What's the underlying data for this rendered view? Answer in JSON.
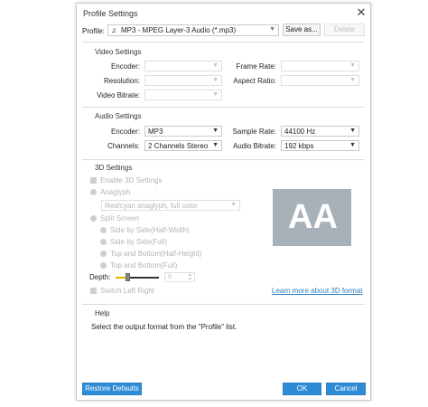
{
  "dialog": {
    "title": "Profile Settings",
    "close_glyph": "✕"
  },
  "profile": {
    "label": "Profile:",
    "value": "MP3 - MPEG Layer-3 Audio (*.mp3)",
    "save_as_label": "Save as...",
    "delete_label": "Delete"
  },
  "video": {
    "section_title": "Video Settings",
    "encoder_label": "Encoder:",
    "resolution_label": "Resolution:",
    "bitrate_label": "Video Bitrate:",
    "frame_rate_label": "Frame Rate:",
    "aspect_ratio_label": "Aspect Ratio:"
  },
  "audio": {
    "section_title": "Audio Settings",
    "encoder_label": "Encoder:",
    "encoder_value": "MP3",
    "channels_label": "Channels:",
    "channels_value": "2 Channels Stereo",
    "sample_rate_label": "Sample Rate:",
    "sample_rate_value": "44100 Hz",
    "bitrate_label": "Audio Bitrate:",
    "bitrate_value": "192 kbps"
  },
  "settings3d": {
    "section_title": "3D Settings",
    "enable_label": "Enable 3D Settings",
    "anaglyph_label": "Anaglyph",
    "anaglyph_value": "Red/cyan anaglyph, full color",
    "split_screen_label": "Split Screen",
    "side_half_label": "Side by Side(Half-Width)",
    "side_full_label": "Side by Side(Full)",
    "top_half_label": "Top and Bottom(Half-Height)",
    "top_full_label": "Top and Bottom(Full)",
    "depth_label": "Depth:",
    "depth_value": "5",
    "switch_label": "Switch Left Right",
    "preview_text": "AA",
    "learn_more_label": "Learn more about 3D format"
  },
  "help": {
    "section_title": "Help",
    "text": "Select the output format from the \"Profile\" list."
  },
  "footer": {
    "restore_label": "Restore Defaults",
    "ok_label": "OK",
    "cancel_label": "Cancel"
  },
  "colors": {
    "accent": "#2e8bd5",
    "link": "#2a7fc4",
    "slider_fill": "#e9b200",
    "preview_bg": "#a8b0b8"
  },
  "icons": {
    "profile_format": "music-note-icon",
    "dropdown": "chevron-down-icon"
  }
}
